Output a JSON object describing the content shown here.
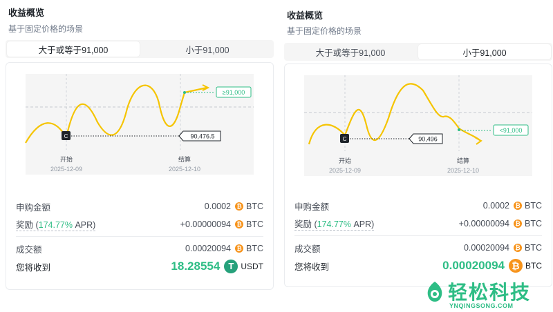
{
  "left": {
    "title": "收益概览",
    "subtitle": "基于固定价格的场景",
    "tabs": [
      "大于或等于91,000",
      "小于91,000"
    ],
    "active_tab": 0,
    "chart": {
      "target_label": "≥91,000",
      "price_label": "90,476.5",
      "start_label": "开始",
      "start_date": "2025-12-09",
      "end_label": "结算",
      "end_date": "2025-12-10",
      "marker": "C"
    },
    "rows": {
      "subscribe_label": "申购金额",
      "subscribe_value": "0.0002",
      "subscribe_unit": "BTC",
      "reward_label_a": "奖励 (",
      "reward_apr": "174.77%",
      "reward_label_b": " APR)",
      "reward_value": "+0.00000094",
      "reward_unit": "BTC",
      "volume_label": "成交额",
      "volume_value": "0.00020094",
      "volume_unit": "BTC",
      "receive_label": "您将收到",
      "receive_value": "18.28554",
      "receive_unit": "USDT"
    }
  },
  "right": {
    "title": "收益概览",
    "subtitle": "基于固定价格的场景",
    "tabs": [
      "大于或等于91,000",
      "小于91,000"
    ],
    "active_tab": 1,
    "chart": {
      "target_label": "<91,000",
      "price_label": "90,496",
      "start_label": "开始",
      "start_date": "2025-12-09",
      "end_label": "结算",
      "end_date": "2025-12-10",
      "marker": "C"
    },
    "rows": {
      "subscribe_label": "申购金额",
      "subscribe_value": "0.0002",
      "subscribe_unit": "BTC",
      "reward_label_a": "奖励 (",
      "reward_apr": "174.77%",
      "reward_label_b": " APR)",
      "reward_value": "+0.00000094",
      "reward_unit": "BTC",
      "volume_label": "成交额",
      "volume_value": "0.00020094",
      "volume_unit": "BTC",
      "receive_label": "您将收到",
      "receive_value": "0.00020094",
      "receive_unit": "BTC"
    }
  },
  "icons": {
    "btc": "₿",
    "usdt": "T"
  },
  "colors": {
    "accent_green": "#2ebd85",
    "curve_yellow": "#f0c400",
    "btc_orange": "#f7931a",
    "usdt_green": "#26a17b"
  },
  "watermark": {
    "text": "轻松科技",
    "sub": "YNQINGSONG.COM"
  }
}
